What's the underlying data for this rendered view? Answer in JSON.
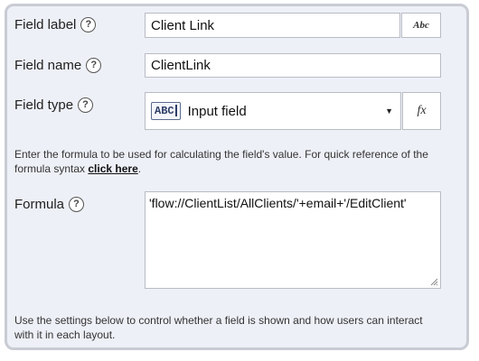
{
  "field_label": {
    "label": "Field label",
    "help": "?",
    "value": "Client Link",
    "format_button": "Abc"
  },
  "field_name": {
    "label": "Field name",
    "help": "?",
    "value": "ClientLink"
  },
  "field_type": {
    "label": "Field type",
    "help": "?",
    "badge": "ABC",
    "selected": "Input field",
    "arrow": "▼",
    "fx_button": "fx"
  },
  "formula_hint": {
    "text": "Enter the formula to be used for calculating the field's value. For quick reference of the formula syntax ",
    "link": "click here",
    "suffix": "."
  },
  "formula": {
    "label": "Formula",
    "help": "?",
    "value": "'flow://ClientList/AllClients/'+email+'/EditClient'"
  },
  "settings_hint": {
    "text": "Use the settings below to control whether a field is shown and how users can interact with it in each layout."
  }
}
